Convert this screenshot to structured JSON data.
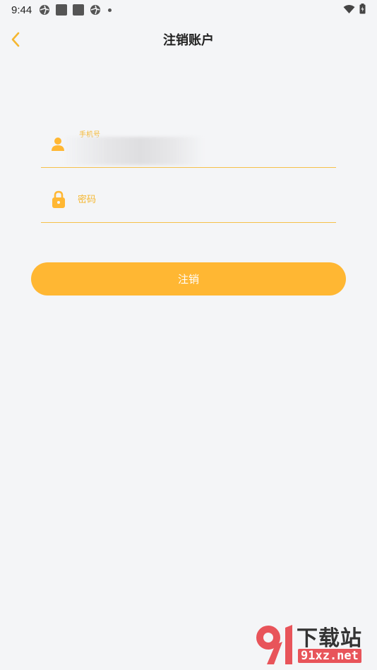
{
  "status_bar": {
    "time": "9:44"
  },
  "header": {
    "title": "注销账户",
    "back_icon": "chevron-left-icon"
  },
  "form": {
    "phone": {
      "label": "手机号",
      "icon": "user-icon",
      "value": ""
    },
    "password": {
      "placeholder": "密码",
      "icon": "lock-icon"
    },
    "submit_label": "注销"
  },
  "colors": {
    "accent": "#ffb733",
    "underline": "#f5c04a",
    "background": "#f4f5f7"
  },
  "watermark": {
    "line1": "下载站",
    "line2": "91xz.net"
  }
}
